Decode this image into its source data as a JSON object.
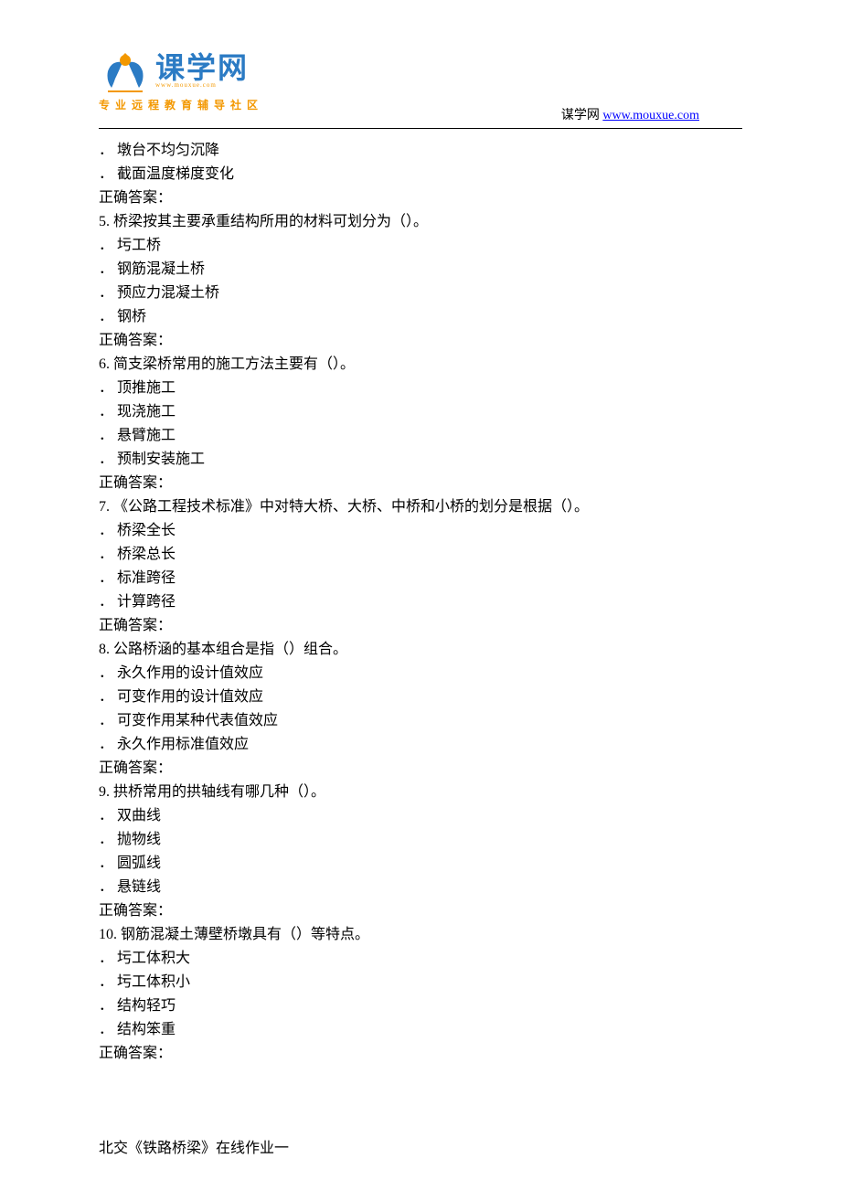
{
  "header": {
    "logo_main": "课学网",
    "logo_url_text": "www.mouxue.com",
    "logo_sub": "专业远程教育辅导社区",
    "site_name": "谋学网",
    "site_link": "www.mouxue.com"
  },
  "content": {
    "lines": [
      "． 墩台不均匀沉降",
      "． 截面温度梯度变化",
      "正确答案：",
      "5.    桥梁按其主要承重结构所用的材料可划分为（）。",
      "． 圬工桥",
      "． 钢筋混凝土桥",
      "． 预应力混凝土桥",
      "． 钢桥",
      "正确答案：",
      "6.    简支梁桥常用的施工方法主要有（）。",
      "． 顶推施工",
      "． 现浇施工",
      "． 悬臂施工",
      "． 预制安装施工",
      "正确答案：",
      "7.    《公路工程技术标准》中对特大桥、大桥、中桥和小桥的划分是根据（）。",
      "． 桥梁全长",
      "． 桥梁总长",
      "． 标准跨径",
      "． 计算跨径",
      "正确答案：",
      "8.    公路桥涵的基本组合是指（）组合。",
      "． 永久作用的设计值效应",
      "． 可变作用的设计值效应",
      "． 可变作用某种代表值效应",
      "． 永久作用标准值效应",
      "正确答案：",
      "9.    拱桥常用的拱轴线有哪几种（）。",
      "． 双曲线",
      "． 抛物线",
      "． 圆弧线",
      "． 悬链线",
      "正确答案：",
      "10.    钢筋混凝土薄壁桥墩具有（）等特点。",
      "． 圬工体积大",
      "． 圬工体积小",
      "． 结构轻巧",
      "． 结构笨重",
      "正确答案："
    ]
  },
  "footer": {
    "text": "北交《铁路桥梁》在线作业一"
  }
}
